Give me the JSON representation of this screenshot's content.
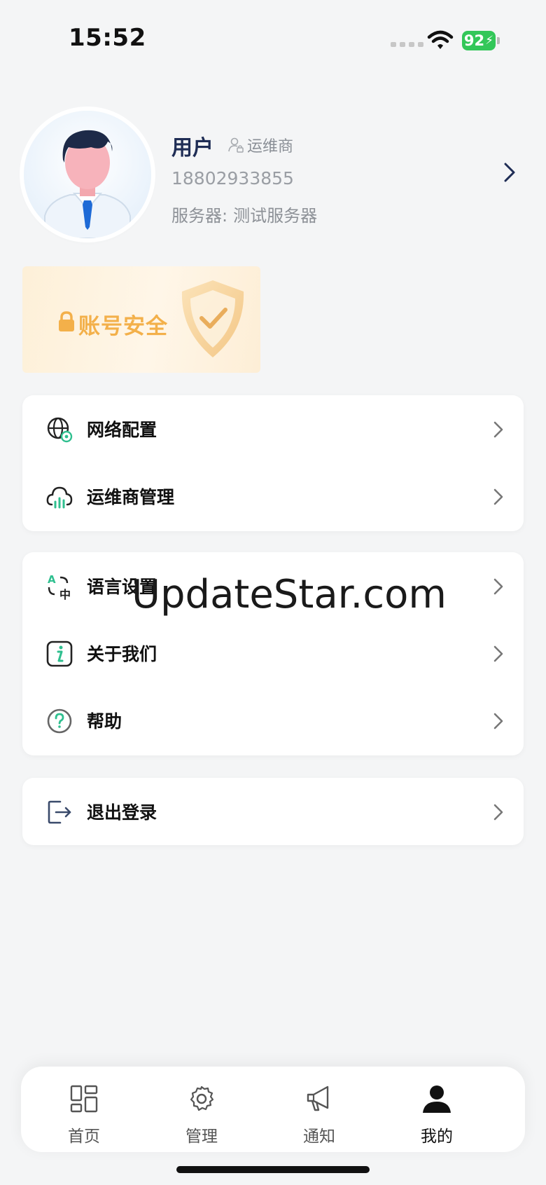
{
  "status_bar": {
    "time": "15:52",
    "battery": "92"
  },
  "profile": {
    "name": "用户",
    "role": "运维商",
    "phone": "18802933855",
    "server_label": "服务器:",
    "server_value": "测试服务器"
  },
  "banner": {
    "text": "账号安全"
  },
  "menu_group1": [
    {
      "label": "网络配置"
    },
    {
      "label": "运维商管理"
    }
  ],
  "menu_group2": [
    {
      "label": "语言设置"
    },
    {
      "label": "关于我们"
    },
    {
      "label": "帮助"
    }
  ],
  "menu_group3": [
    {
      "label": "退出登录"
    }
  ],
  "watermark": "UpdateStar.com",
  "tabs": [
    {
      "label": "首页",
      "icon": "dashboard-icon"
    },
    {
      "label": "管理",
      "icon": "gear-icon"
    },
    {
      "label": "通知",
      "icon": "megaphone-icon"
    },
    {
      "label": "我的",
      "icon": "person-icon",
      "active": true
    }
  ],
  "colors": {
    "accent_green": "#2fbf8f",
    "battery_green": "#33c759",
    "banner_orange": "#f3b04a",
    "name_navy": "#1f2d55"
  }
}
